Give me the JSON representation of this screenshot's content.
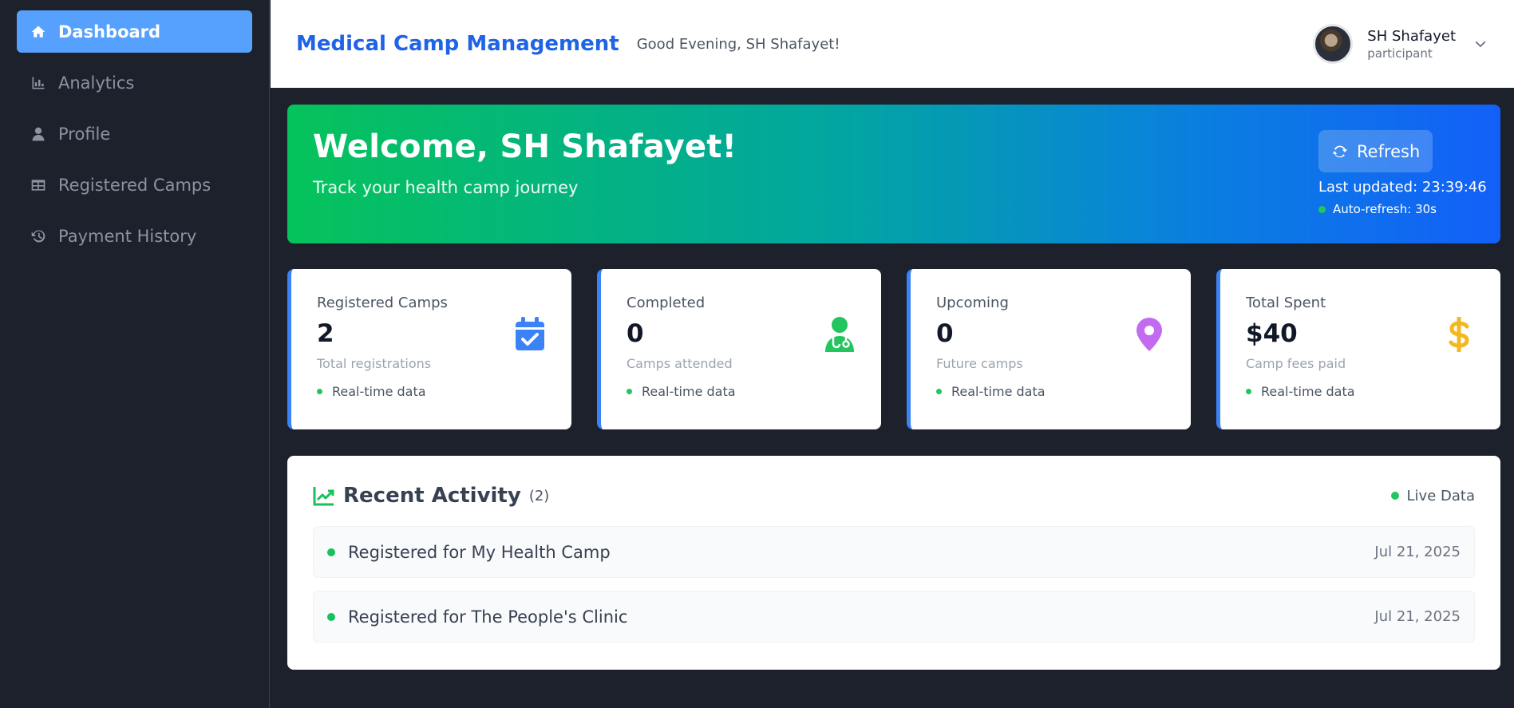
{
  "sidebar": {
    "items": [
      {
        "label": "Dashboard",
        "icon": "home-icon",
        "active": true
      },
      {
        "label": "Analytics",
        "icon": "bar-chart-icon",
        "active": false
      },
      {
        "label": "Profile",
        "icon": "user-icon",
        "active": false
      },
      {
        "label": "Registered Camps",
        "icon": "table-icon",
        "active": false
      },
      {
        "label": "Payment History",
        "icon": "history-icon",
        "active": false
      }
    ]
  },
  "header": {
    "title": "Medical Camp Management",
    "greeting": "Good Evening, SH Shafayet!",
    "user": {
      "name": "SH Shafayet",
      "role": "participant"
    }
  },
  "banner": {
    "heading": "Welcome, SH Shafayet!",
    "subheading": "Track your health camp journey",
    "refresh_label": "Refresh",
    "last_updated": "Last updated: 23:39:46",
    "auto_refresh": "Auto-refresh: 30s"
  },
  "stats": [
    {
      "label": "Registered Camps",
      "value": "2",
      "sub": "Total registrations",
      "live": "Real-time data",
      "icon": "calendar-check-icon",
      "color": "#3b82f6"
    },
    {
      "label": "Completed",
      "value": "0",
      "sub": "Camps attended",
      "live": "Real-time data",
      "icon": "doctor-icon",
      "color": "#22c55e"
    },
    {
      "label": "Upcoming",
      "value": "0",
      "sub": "Future camps",
      "live": "Real-time data",
      "icon": "map-pin-icon",
      "color": "#c26bf0"
    },
    {
      "label": "Total Spent",
      "value": "$40",
      "sub": "Camp fees paid",
      "live": "Real-time data",
      "icon": "dollar-icon",
      "color": "#f2b91f"
    }
  ],
  "activity": {
    "title": "Recent Activity",
    "count": "(2)",
    "live_label": "Live Data",
    "items": [
      {
        "text": "Registered for My Health Camp",
        "date": "Jul 21, 2025"
      },
      {
        "text": "Registered for The People's Clinic",
        "date": "Jul 21, 2025"
      }
    ]
  },
  "colors": {
    "accent": "#56a1fd",
    "brand": "#1f63e6",
    "live": "#22c55e"
  }
}
